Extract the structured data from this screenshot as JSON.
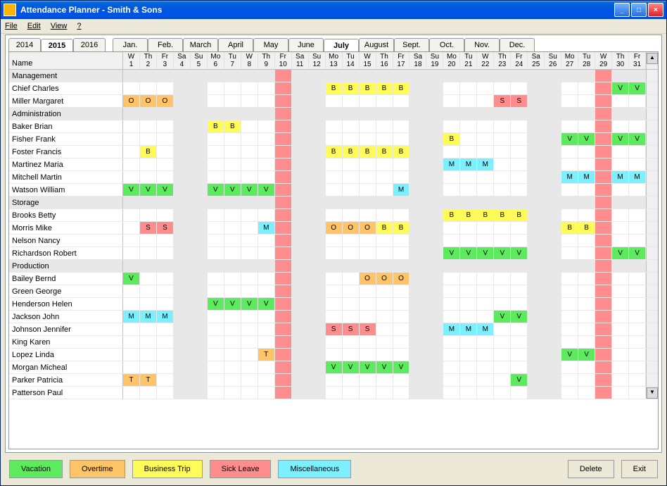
{
  "window": {
    "title": "Attendance Planner - Smith & Sons"
  },
  "menus": [
    "File",
    "Edit",
    "View",
    "?"
  ],
  "years": [
    "2014",
    "2015",
    "2016"
  ],
  "selectedYear": "2015",
  "months": [
    "Jan.",
    "Feb.",
    "March",
    "April",
    "May",
    "June",
    "July",
    "August",
    "Sept.",
    "Oct.",
    "Nov.",
    "Dec."
  ],
  "selectedMonth": "July",
  "nameHeader": "Name",
  "days": [
    {
      "dow": "W",
      "num": "1",
      "we": false
    },
    {
      "dow": "Th",
      "num": "2",
      "we": false
    },
    {
      "dow": "Fr",
      "num": "3",
      "we": false
    },
    {
      "dow": "Sa",
      "num": "4",
      "we": true
    },
    {
      "dow": "Su",
      "num": "5",
      "we": true
    },
    {
      "dow": "Mo",
      "num": "6",
      "we": false
    },
    {
      "dow": "Tu",
      "num": "7",
      "we": false
    },
    {
      "dow": "W",
      "num": "8",
      "we": false
    },
    {
      "dow": "Th",
      "num": "9",
      "we": false
    },
    {
      "dow": "Fr",
      "num": "10",
      "we": false,
      "hol": true
    },
    {
      "dow": "Sa",
      "num": "11",
      "we": true
    },
    {
      "dow": "Su",
      "num": "12",
      "we": true
    },
    {
      "dow": "Mo",
      "num": "13",
      "we": false
    },
    {
      "dow": "Tu",
      "num": "14",
      "we": false
    },
    {
      "dow": "W",
      "num": "15",
      "we": false
    },
    {
      "dow": "Th",
      "num": "16",
      "we": false
    },
    {
      "dow": "Fr",
      "num": "17",
      "we": false
    },
    {
      "dow": "Sa",
      "num": "18",
      "we": true
    },
    {
      "dow": "Su",
      "num": "19",
      "we": true
    },
    {
      "dow": "Mo",
      "num": "20",
      "we": false
    },
    {
      "dow": "Tu",
      "num": "21",
      "we": false
    },
    {
      "dow": "W",
      "num": "22",
      "we": false
    },
    {
      "dow": "Th",
      "num": "23",
      "we": false
    },
    {
      "dow": "Fr",
      "num": "24",
      "we": false
    },
    {
      "dow": "Sa",
      "num": "25",
      "we": true
    },
    {
      "dow": "Su",
      "num": "26",
      "we": true
    },
    {
      "dow": "Mo",
      "num": "27",
      "we": false
    },
    {
      "dow": "Tu",
      "num": "28",
      "we": false
    },
    {
      "dow": "W",
      "num": "29",
      "we": false,
      "hol": true
    },
    {
      "dow": "Th",
      "num": "30",
      "we": false
    },
    {
      "dow": "Fr",
      "num": "31",
      "we": false
    }
  ],
  "rows": [
    {
      "name": "Management",
      "group": true,
      "cells": {}
    },
    {
      "name": "Chief Charles",
      "cells": {
        "12": "B",
        "13": "B",
        "14": "B",
        "15": "B",
        "16": "B",
        "29": "V",
        "30": "V"
      }
    },
    {
      "name": "Miller Margaret",
      "cells": {
        "0": "O",
        "1": "O",
        "2": "O",
        "22": "S",
        "23": "S"
      }
    },
    {
      "name": "Administration",
      "group": true,
      "cells": {}
    },
    {
      "name": "Baker Brian",
      "cells": {
        "5": "B",
        "6": "B"
      }
    },
    {
      "name": "Fisher Frank",
      "cells": {
        "19": "B",
        "26": "V",
        "27": "V",
        "29": "V",
        "30": "V"
      }
    },
    {
      "name": "Foster Francis",
      "cells": {
        "1": "B",
        "12": "B",
        "13": "B",
        "14": "B",
        "15": "B",
        "16": "B"
      }
    },
    {
      "name": "Martinez Maria",
      "cells": {
        "19": "M",
        "20": "M",
        "21": "M"
      }
    },
    {
      "name": "Mitchell Martin",
      "cells": {
        "26": "M",
        "27": "M",
        "29": "M",
        "30": "M"
      }
    },
    {
      "name": "Watson William",
      "cells": {
        "0": "V",
        "1": "V",
        "2": "V",
        "5": "V",
        "6": "V",
        "7": "V",
        "8": "V",
        "16": "M"
      }
    },
    {
      "name": "Storage",
      "group": true,
      "cells": {}
    },
    {
      "name": "Brooks Betty",
      "cells": {
        "19": "B",
        "20": "B",
        "21": "B",
        "22": "B",
        "23": "B"
      }
    },
    {
      "name": "Morris Mike",
      "cells": {
        "1": "S",
        "2": "S",
        "8": "M",
        "12": "O",
        "13": "O",
        "14": "O",
        "15": "B",
        "16": "B",
        "26": "B",
        "27": "B"
      }
    },
    {
      "name": "Nelson Nancy",
      "cells": {}
    },
    {
      "name": "Richardson Robert",
      "cells": {
        "19": "V",
        "20": "V",
        "21": "V",
        "22": "V",
        "23": "V",
        "29": "V",
        "30": "V"
      }
    },
    {
      "name": "Production",
      "group": true,
      "cells": {}
    },
    {
      "name": "Bailey Bernd",
      "cells": {
        "0": "V",
        "14": "O",
        "15": "O",
        "16": "O"
      }
    },
    {
      "name": "Green George",
      "cells": {}
    },
    {
      "name": "Henderson Helen",
      "cells": {
        "5": "V",
        "6": "V",
        "7": "V",
        "8": "V"
      }
    },
    {
      "name": "Jackson John",
      "cells": {
        "0": "M",
        "1": "M",
        "2": "M",
        "22": "V",
        "23": "V"
      }
    },
    {
      "name": "Johnson Jennifer",
      "cells": {
        "12": "S",
        "13": "S",
        "14": "S",
        "19": "M",
        "20": "M",
        "21": "M"
      }
    },
    {
      "name": "King Karen",
      "cells": {}
    },
    {
      "name": "Lopez Linda",
      "cells": {
        "8": "T",
        "26": "V",
        "27": "V"
      }
    },
    {
      "name": "Morgan Micheal",
      "cells": {
        "12": "V",
        "13": "V",
        "14": "V",
        "15": "V",
        "16": "V"
      }
    },
    {
      "name": "Parker Patricia",
      "cells": {
        "0": "T",
        "1": "T",
        "23": "V"
      }
    },
    {
      "name": "Patterson Paul",
      "cells": {}
    }
  ],
  "legend": [
    {
      "label": "Vacation",
      "cls": "lb-V"
    },
    {
      "label": "Overtime",
      "cls": "lb-O"
    },
    {
      "label": "Business Trip",
      "cls": "lb-B"
    },
    {
      "label": "Sick Leave",
      "cls": "lb-S"
    },
    {
      "label": "Miscellaneous",
      "cls": "lb-M"
    }
  ],
  "buttons": {
    "delete": "Delete",
    "exit": "Exit"
  }
}
